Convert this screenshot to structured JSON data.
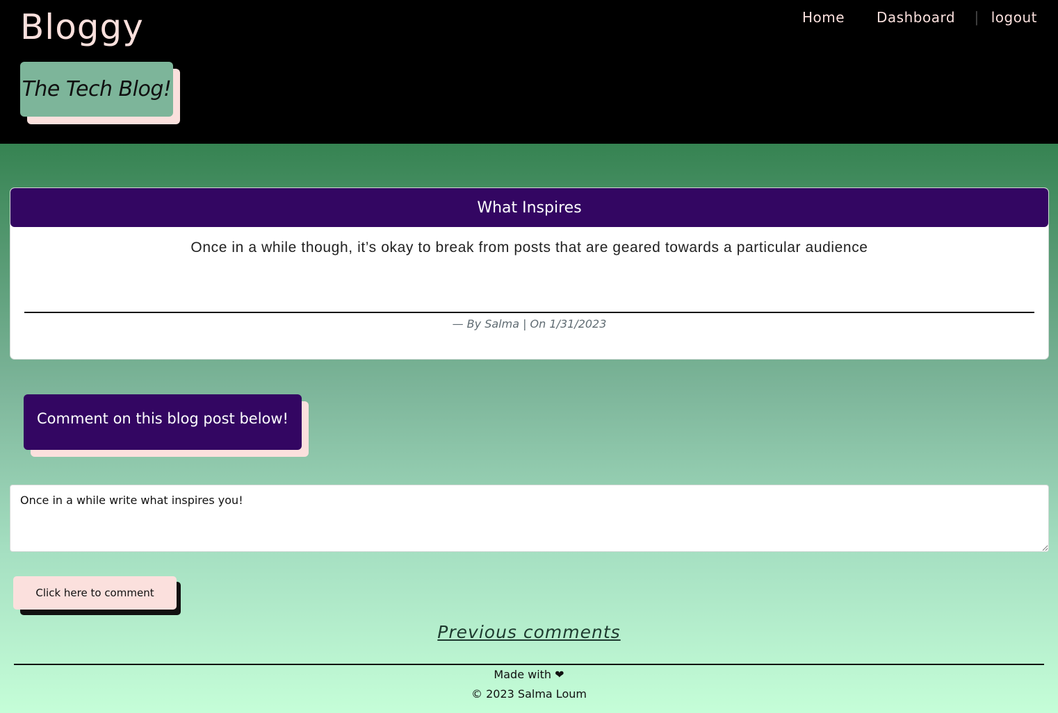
{
  "header": {
    "brand": "Bloggy",
    "tagline": "The Tech Blog!",
    "nav": {
      "home": "Home",
      "dashboard": "Dashboard",
      "separator": "|",
      "logout": "logout"
    }
  },
  "post": {
    "title": "What Inspires",
    "body": "Once in a while though, it’s okay to break from posts that are geared towards a particular audience",
    "meta": "— By Salma | On 1/31/2023"
  },
  "comment_form": {
    "heading": "Comment on this blog post below!",
    "value": "Once in a while write what inspires you!",
    "submit_label": "Click here to comment"
  },
  "previous_comments_label": "Previous comments",
  "footer": {
    "made_with": "Made with ❤",
    "copyright": "© 2023 Salma Loum"
  },
  "colors": {
    "header_bg": "#000000",
    "accent_purple": "#330662",
    "accent_pink": "#fbe0dd",
    "tagline_green": "#7db59a"
  }
}
